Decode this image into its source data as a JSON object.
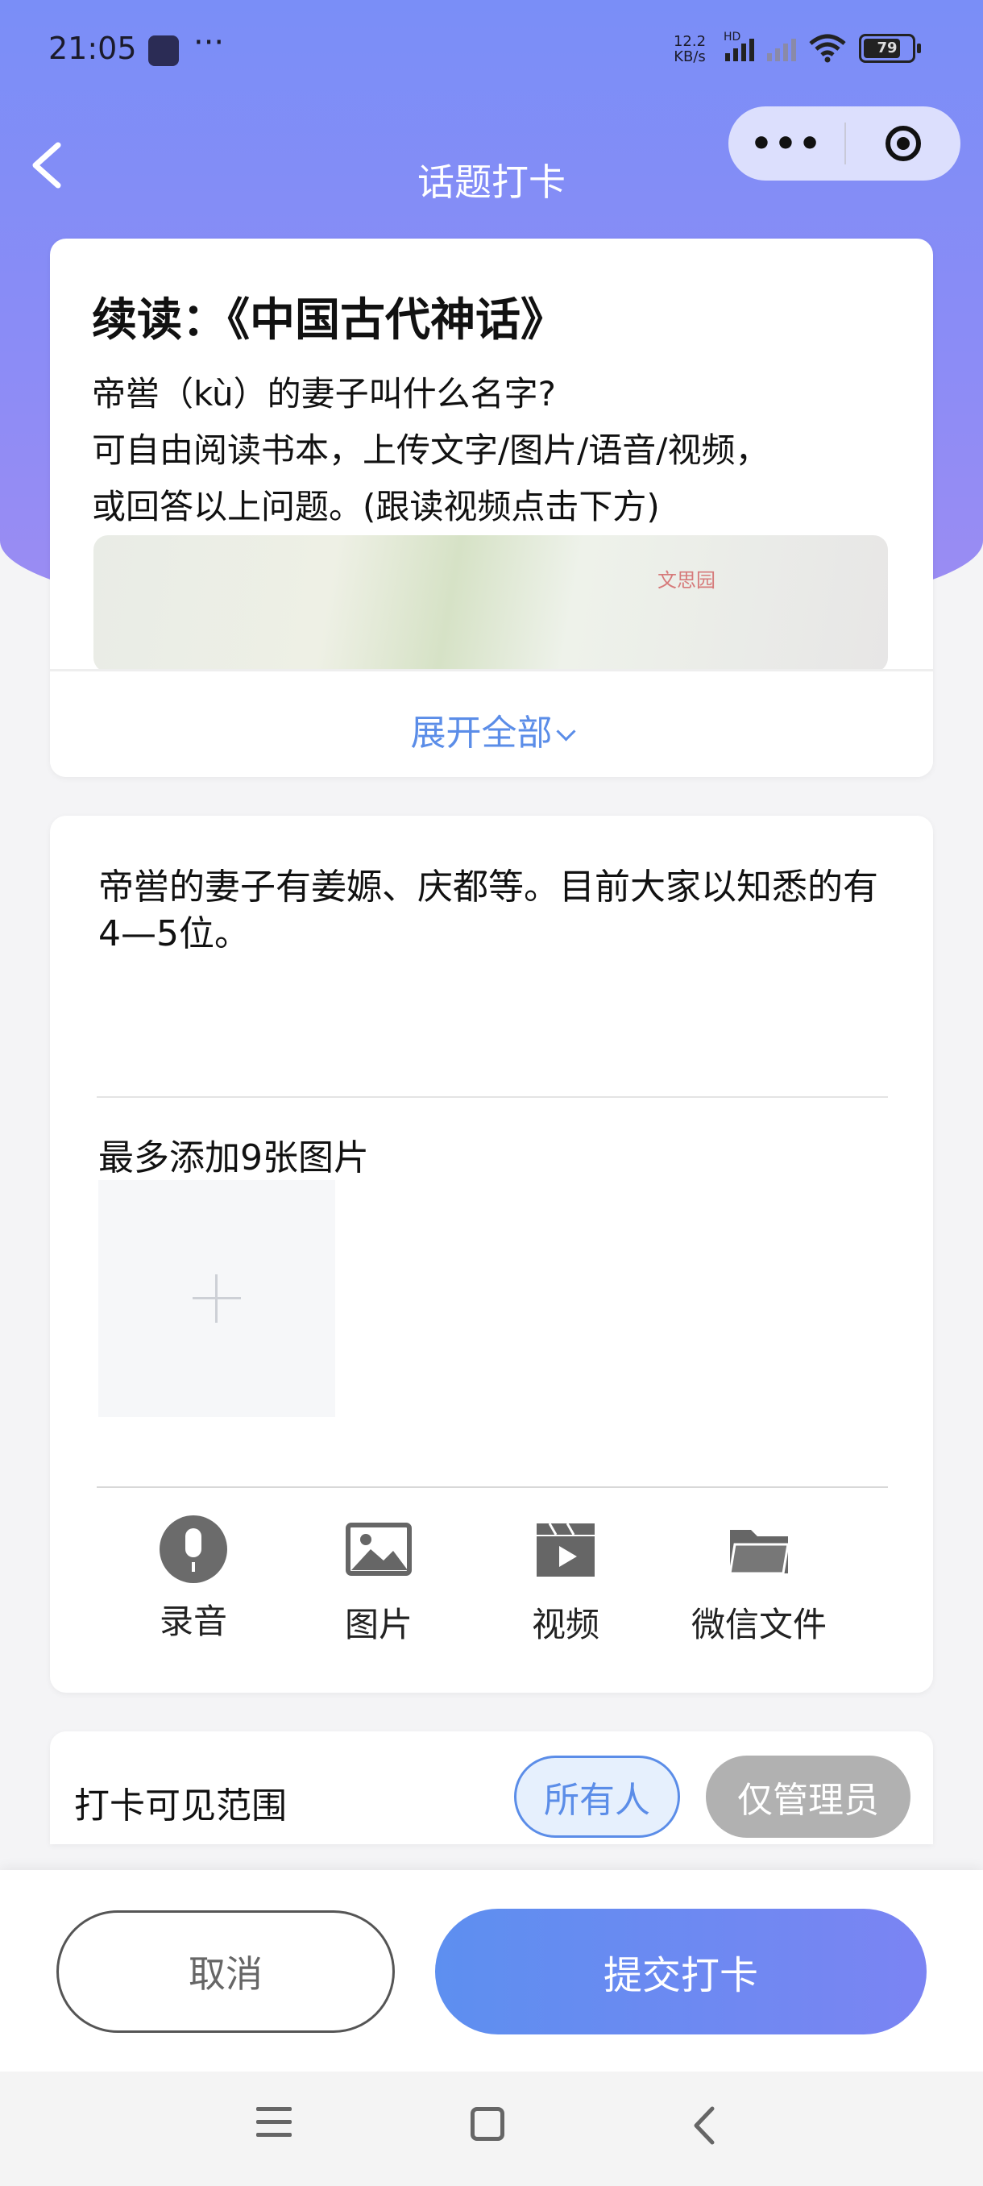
{
  "status_bar": {
    "time": "21:05",
    "more": "···",
    "net_speed_value": "12.2",
    "net_speed_unit": "KB/s",
    "net_type": "HD",
    "battery": "79"
  },
  "header": {
    "title": "话题打卡",
    "back_icon": "chevron-left-icon",
    "menu_dots": "•••"
  },
  "topic": {
    "title": "续读：《中国古代神话》",
    "question_lines": [
      "帝喾（kù）的妻子叫什么名字?",
      "可自由阅读书本，上传文字/图片/语音/视频，",
      "或回答以上问题。(跟读视频点击下方)"
    ],
    "video_logo": "文思园",
    "expand_label": "展开全部"
  },
  "answer": {
    "text": "帝喾的妻子有姜嫄、庆都等。目前大家以知悉的有4—5位。",
    "image_hint": "最多添加9张图片",
    "tools": [
      {
        "label": "录音",
        "icon": "microphone-icon"
      },
      {
        "label": "图片",
        "icon": "image-icon"
      },
      {
        "label": "视频",
        "icon": "video-icon"
      },
      {
        "label": "微信文件",
        "icon": "folder-icon"
      }
    ]
  },
  "scope": {
    "label": "打卡可见范围",
    "options": [
      "所有人",
      "仅管理员"
    ],
    "selected": "所有人"
  },
  "actions": {
    "cancel": "取消",
    "submit": "提交打卡"
  },
  "colors": {
    "header_gradient_top": "#7a8ef7",
    "accent_blue": "#5b8de8",
    "submit_gradient_end": "#7b84f3"
  }
}
